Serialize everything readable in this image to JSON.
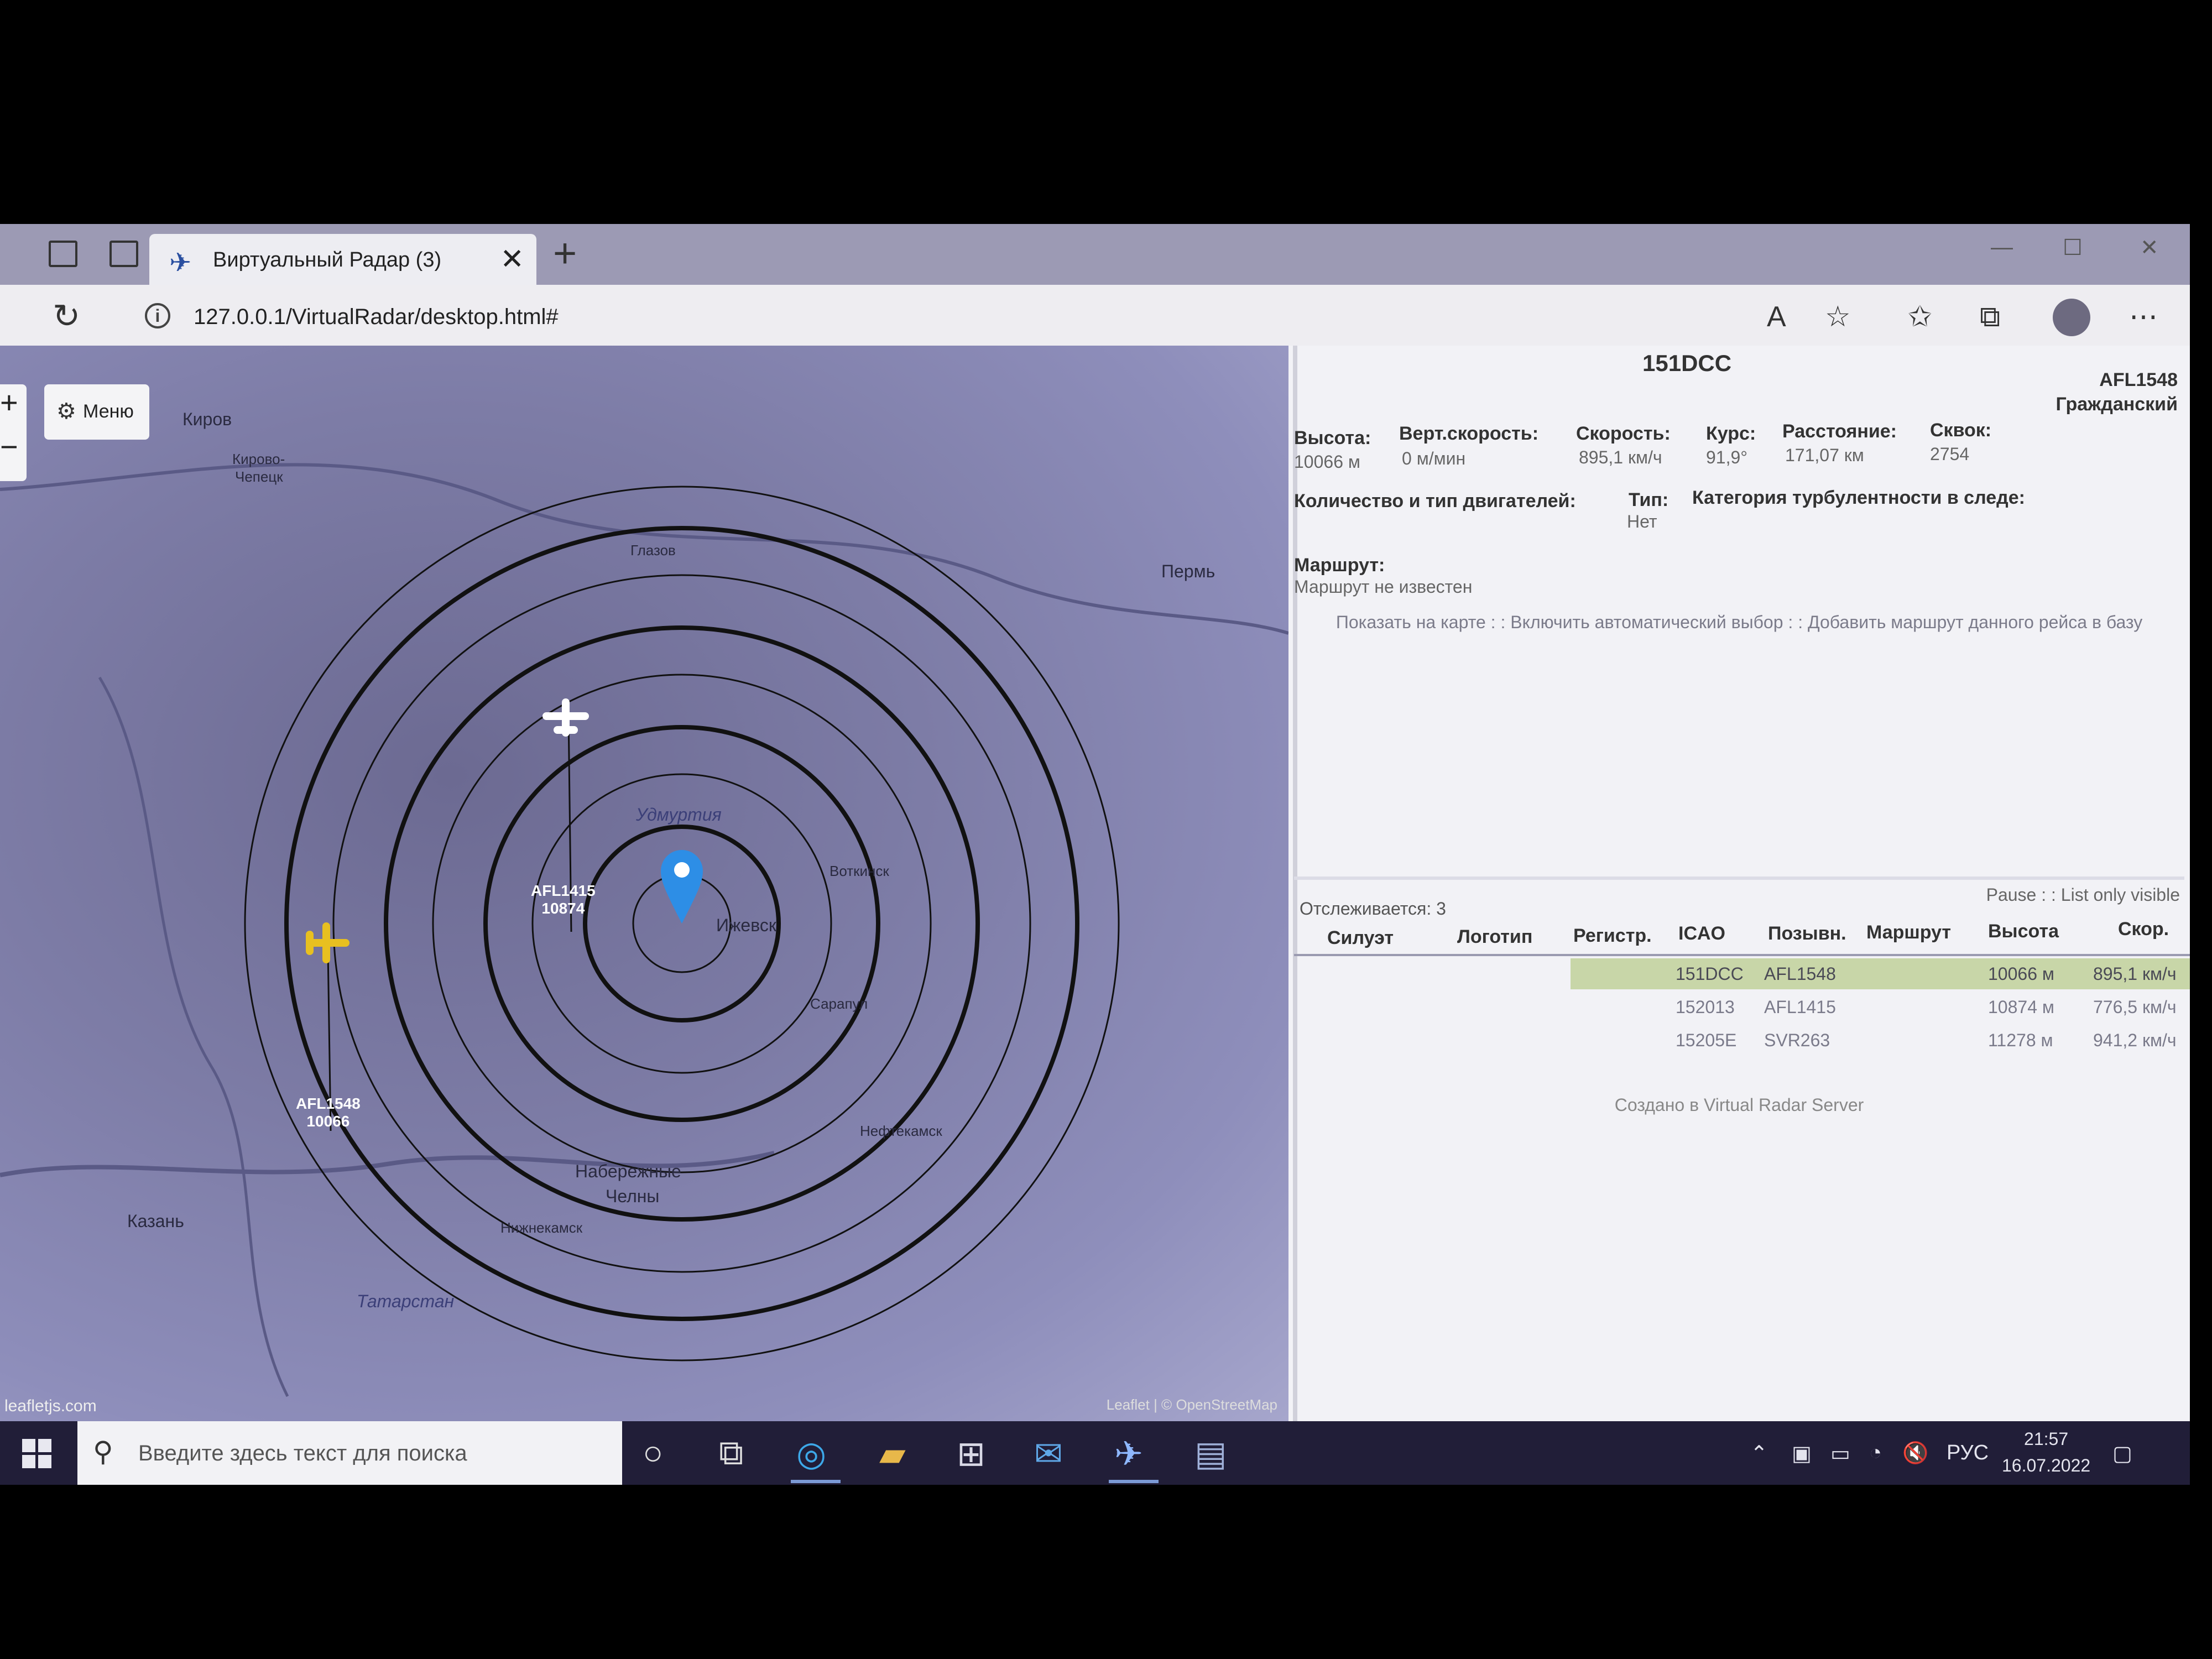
{
  "browser": {
    "tab_title": "Виртуальный Радар (3)",
    "tab_close": "✕",
    "new_tab": "+",
    "url": "127.0.0.1/VirtualRadar/desktop.html#"
  },
  "map": {
    "menu_label": "Меню",
    "zoom_in": "+",
    "zoom_out": "−",
    "cities": [
      "Киров",
      "Кирово-",
      "Чепецк",
      "Глазов",
      "Пермь",
      "Удмуртия",
      "Воткинск",
      "Ижевск",
      "Сарапул",
      "Нефтекамск",
      "Набережные",
      "Челны",
      "Нижнекамск",
      "Казань",
      "Татарстан"
    ],
    "aircraft": [
      {
        "callsign": "AFL1415",
        "altitude": "10874",
        "color": "#ffffff"
      },
      {
        "callsign": "AFL1548",
        "altitude": "10066",
        "color": "#e8c020"
      }
    ],
    "attribution": "Leaflet | © OpenStreetMap",
    "leaflet_logo": "leafletjs.com"
  },
  "details": {
    "registration": "151DCC",
    "callsign": "AFL1548",
    "category": "Гражданский",
    "fields": [
      {
        "label": "Высота:",
        "value": "10066 м"
      },
      {
        "label": "Верт.скорость:",
        "value": "0 м/мин"
      },
      {
        "label": "Скорость:",
        "value": "895,1 км/ч"
      },
      {
        "label": "Курс:",
        "value": "91,9°"
      },
      {
        "label": "Расстояние:",
        "value": "171,07 км"
      },
      {
        "label": "Сквок:",
        "value": "2754"
      }
    ],
    "engines_label": "Количество и тип двигателей:",
    "type_label": "Тип:",
    "type_value": "Нет",
    "turbulence_label": "Категория турбулентности в следе:",
    "route_label": "Маршрут:",
    "route_value": "Маршрут не известен",
    "links": "Показать на карте : : Включить автоматический выбор : : Добавить маршрут данного рейса в базу"
  },
  "list": {
    "tracked": "Отслеживается: 3",
    "controls": "Pause : : List only visible",
    "headers": [
      "Силуэт",
      "Логотип",
      "Регистр.",
      "ICAO",
      "Позывн.",
      "Маршрут",
      "Высота",
      "Скор."
    ],
    "rows": [
      {
        "icao": "151DCC",
        "callsign": "AFL1548",
        "altitude": "10066 м",
        "speed": "895,1 км/ч",
        "selected": true
      },
      {
        "icao": "152013",
        "callsign": "AFL1415",
        "altitude": "10874 м",
        "speed": "776,5 км/ч",
        "selected": false
      },
      {
        "icao": "15205E",
        "callsign": "SVR263",
        "altitude": "11278 м",
        "speed": "941,2 км/ч",
        "selected": false
      }
    ],
    "footer": "Создано в Virtual Radar Server"
  },
  "taskbar": {
    "search_placeholder": "Введите здесь текст для поиска",
    "language": "РУС",
    "time": "21:57",
    "date": "16.07.2022"
  }
}
